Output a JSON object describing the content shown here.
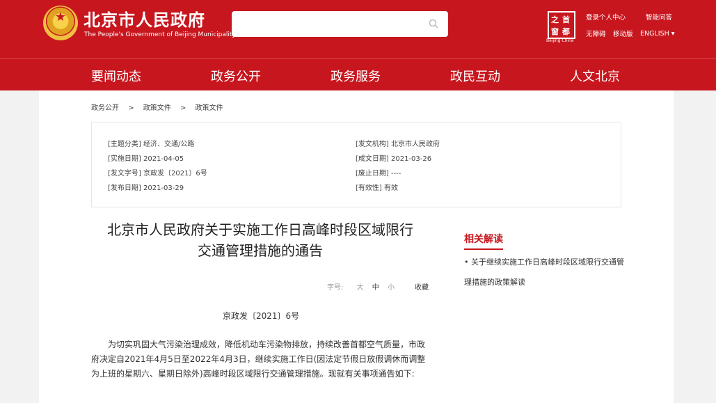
{
  "header": {
    "title": "北京市人民政府",
    "subtitle": "The People's Government of Beijing Municipality",
    "search": {
      "value": "",
      "placeholder": ""
    },
    "logo_chars": [
      "首",
      "都",
      "之",
      "窗"
    ],
    "logo_caption": "Beijing·China",
    "links": {
      "login": "登录个人中心",
      "smart_qa": "智能问答",
      "accessibility": "无障碍",
      "mobile": "移动版",
      "english": "ENGLISH ▾"
    },
    "brand_color": "#c8161e"
  },
  "nav": [
    "要闻动态",
    "政务公开",
    "政务服务",
    "政民互动",
    "人文北京"
  ],
  "breadcrumb": [
    "政务公开",
    ">",
    "政策文件",
    ">",
    "政策文件"
  ],
  "meta": {
    "topic": "[主题分类] 经济、交通/公路",
    "issuer": "[发文机构] 北京市人民政府",
    "effective_date": "[实施日期] 2021-04-05",
    "written_date": "[成文日期] 2021-03-26",
    "doc_no": "[发文字号] 京政发〔2021〕6号",
    "abolish_date": "[废止日期] ----",
    "publish_date": "[发布日期] 2021-03-29",
    "validity": "[有效性] 有效"
  },
  "article": {
    "title_line1": "北京市人民政府关于实施工作日高峰时段区域限行",
    "title_line2": "交通管理措施的通告",
    "font_label": "字号:",
    "font_large": "大",
    "font_medium": "中",
    "font_small": "小",
    "collect": "收藏",
    "doc_number": "京政发〔2021〕6号",
    "body": "为切实巩固大气污染治理成效，降低机动车污染物排放，持续改善首都空气质量，市政府决定自2021年4月5日至2022年4月3日，继续实施工作日(因法定节假日放假调休而调整为上班的星期六、星期日除外)高峰时段区域限行交通管理措施。现就有关事项通告如下:"
  },
  "related": {
    "title": "相关解读",
    "items": [
      "• 关于继续实施工作日高峰时段区域限行交通管理措施的政策解读"
    ]
  }
}
